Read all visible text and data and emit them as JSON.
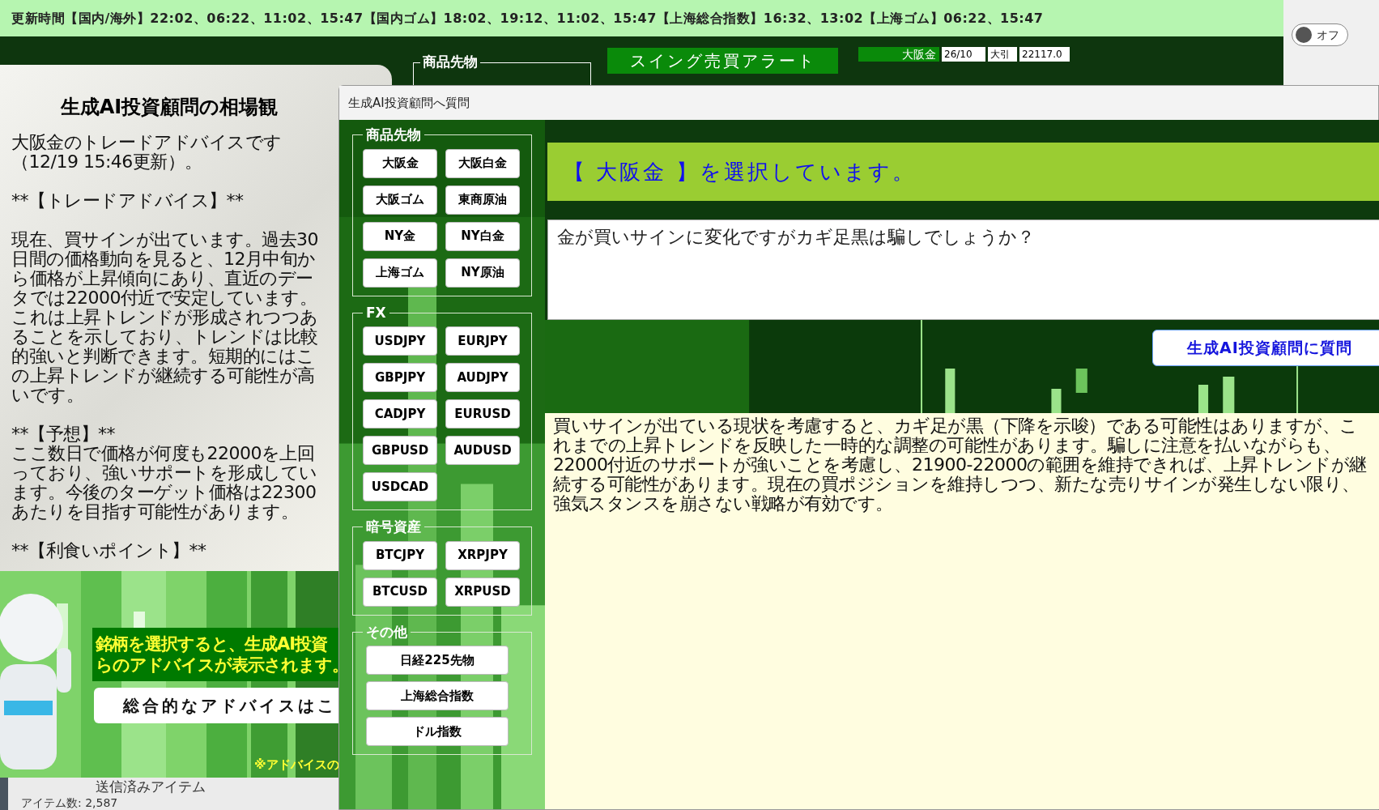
{
  "update_bar": {
    "text": "更新時間【国内/海外】22:02、06:22、11:02、15:47【国内ゴム】18:02、19:12、11:02、15:47【上海総合指数】16:32、13:02【上海ゴム】06:22、15:47"
  },
  "toggle": {
    "label": "オフ",
    "on": false
  },
  "background_app": {
    "section_label": "商品先物",
    "alert_button": "スイング売買アラート",
    "tickers": [
      {
        "name": "大阪金",
        "month": "26/10",
        "session": "大引",
        "price": "22117.0"
      }
    ]
  },
  "advice_panel": {
    "title": "生成AI投資顧問の相場観",
    "paragraphs": [
      "大阪金のトレードアドバイスです（12/19 15:46更新）。",
      "**【トレードアドバイス】**",
      "現在、買サインが出ています。過去30日間の価格動向を見ると、12月中旬から価格が上昇傾向にあり、直近のデータでは22000付近で安定しています。これは上昇トレンドが形成されつつあることを示しており、トレンドは比較的強いと判断できます。短期的にはこの上昇トレンドが継続する可能性が高いです。",
      "**【予想】**\nここ数日で価格が何度も22000を上回っており、強いサポートを形成しています。今後のターゲット価格は22300あたりを目指す可能性があります。",
      "**【利食いポイント】**"
    ]
  },
  "promo": {
    "notice_lines": [
      "銘柄を選択すると、生成AI投資",
      "らのアドバイスが表示されます。"
    ],
    "button": "総合的なアドバイスはこ",
    "footnote": "※アドバイスの"
  },
  "status": {
    "folder": "送信済みアイテム",
    "count": "アイテム数: 2,587"
  },
  "dialog": {
    "title": "生成AI投資顧問へ質問",
    "groups": [
      {
        "label": "商品先物",
        "kind": "grid",
        "buttons": [
          "大阪金",
          "大阪白金",
          "大阪ゴム",
          "東商原油",
          "NY金",
          "NY白金",
          "上海ゴム",
          "NY原油"
        ]
      },
      {
        "label": "FX",
        "kind": "grid",
        "buttons": [
          "USDJPY",
          "EURJPY",
          "GBPJPY",
          "AUDJPY",
          "CADJPY",
          "EURUSD",
          "GBPUSD",
          "AUDUSD",
          "USDCAD"
        ]
      },
      {
        "label": "暗号資産",
        "kind": "grid",
        "buttons": [
          "BTCJPY",
          "XRPJPY",
          "BTCUSD",
          "XRPUSD"
        ]
      },
      {
        "label": "その他",
        "kind": "stack",
        "buttons": [
          "日経225先物",
          "上海総合指数",
          "ドル指数"
        ]
      }
    ],
    "selection_banner": "【 大阪金 】を選択しています。",
    "question": "金が買いサインに変化ですがカギ足黒は騙しでしょうか？",
    "ask_button": "生成AI投資顧問に質問",
    "answer": "買いサインが出ている現状を考慮すると、カギ足が黒（下降を示唆）である可能性はありますが、これまでの上昇トレンドを反映した一時的な調整の可能性があります。騙しに注意を払いながらも、22000付近のサポートが強いことを考慮し、21900-22000の範囲を維持できれば、上昇トレンドが継続する可能性があります。現在の買ポジションを維持しつつ、新たな売りサインが発生しない限り、強気スタンスを崩さない戦略が有効です。"
  }
}
